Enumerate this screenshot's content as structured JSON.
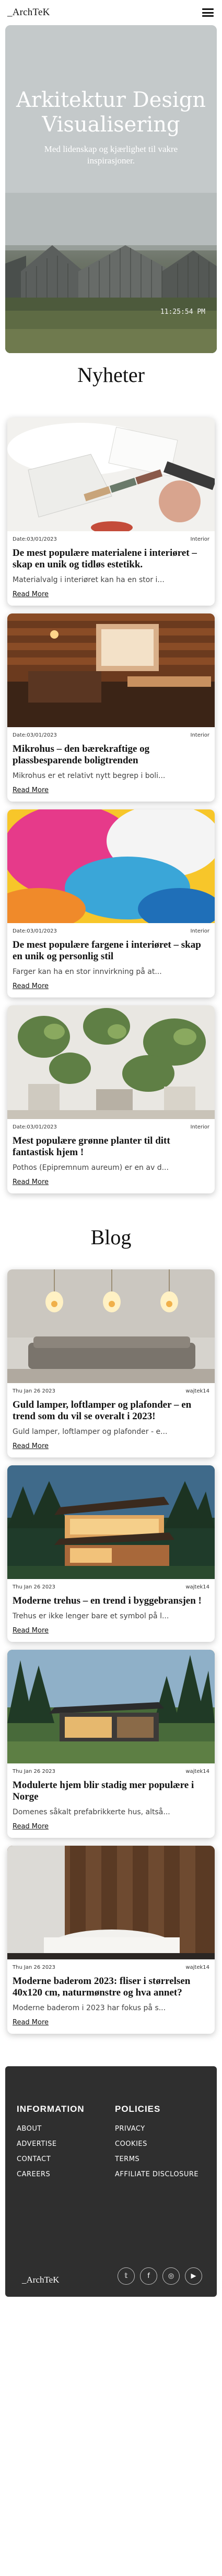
{
  "header": {
    "logo": "_ArchTeK",
    "menu_icon": "hamburger-menu-icon"
  },
  "hero": {
    "title": "Arkitektur Design Visualisering",
    "subtitle": "Med lidenskap og kjærlighet til vakre inspirasjoner.",
    "timestamp": "11:25:54 PM"
  },
  "news": {
    "title": "Nyheter",
    "cards": [
      {
        "date": "Date:03/01/2023",
        "category": "Interior",
        "title": "De mest populære materialene i interiøret – skap en unik og tidløs estetikk.",
        "excerpt": "Materialvalg i interiøret kan ha en stor i...",
        "link": "Read More"
      },
      {
        "date": "Date:03/01/2023",
        "category": "Interior",
        "title": "Mikrohus – den bærekraftige og plassbesparende boligtrenden",
        "excerpt": "Mikrohus er et relativt nytt begrep i boli...",
        "link": "Read More"
      },
      {
        "date": "Date:03/01/2023",
        "category": "Interior",
        "title": "De mest populære fargene i interiøret – skap en unik og personlig stil",
        "excerpt": "Farger kan ha en stor innvirkning på at...",
        "link": "Read More"
      },
      {
        "date": "Date:03/01/2023",
        "category": "Interior",
        "title": "Mest populære grønne planter til ditt fantastisk hjem !",
        "excerpt": "Pothos (Epipremnum aureum) er en av d...",
        "link": "Read More"
      }
    ]
  },
  "blog": {
    "title": "Blog",
    "cards": [
      {
        "date": "Thu Jan 26 2023",
        "author": "wajtek14",
        "title": "Guld lamper, loftlamper og plafonder – en trend som du vil se overalt i 2023!",
        "excerpt": "Guld lamper, loftlamper og plafonder - e...",
        "link": "Read More"
      },
      {
        "date": "Thu Jan 26 2023",
        "author": "wajtek14",
        "title": "Moderne trehus – en trend i byggebransjen !",
        "excerpt": "Trehus er ikke lenger bare et symbol på l...",
        "link": "Read More"
      },
      {
        "date": "Thu Jan 26 2023",
        "author": "wajtek14",
        "title": "Modulerte hjem blir stadig mer populære i Norge",
        "excerpt": "Domenes såkalt prefabrikkerte hus, altså...",
        "link": "Read More"
      },
      {
        "date": "Thu Jan 26 2023",
        "author": "wajtek14",
        "title": "Moderne baderom 2023: fliser i størrelsen 40x120 cm, naturmønstre og hva annet?",
        "excerpt": "Moderne baderom i 2023 har fokus på s...",
        "link": "Read More"
      }
    ]
  },
  "footer": {
    "information_title": "INFORMATION",
    "information_links": [
      "ABOUT",
      "ADVERTISE",
      "CONTACT",
      "CAREERS"
    ],
    "policies_title": "POLICIES",
    "policies_links": [
      "PRIVACY",
      "COOKIES",
      "TERMS",
      "AFFILIATE DISCLOSURE"
    ],
    "logo": "_ArchTeK",
    "socials": [
      {
        "icon": "twitter-icon",
        "glyph": "𝕥"
      },
      {
        "icon": "facebook-icon",
        "glyph": "f"
      },
      {
        "icon": "instagram-icon",
        "glyph": "◎"
      },
      {
        "icon": "youtube-icon",
        "glyph": "▶"
      }
    ]
  }
}
